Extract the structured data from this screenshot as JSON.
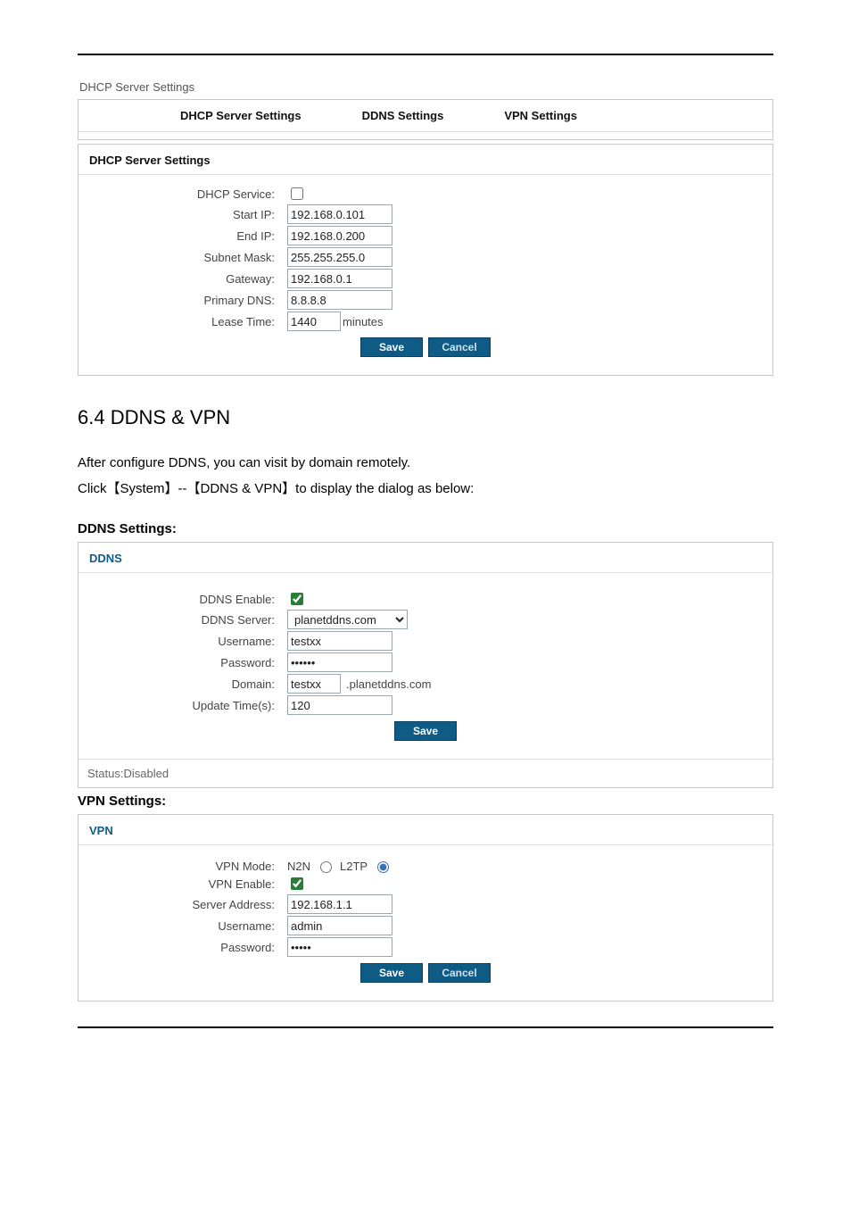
{
  "caption": "DHCP Server Settings",
  "tabs": {
    "dhcp": "DHCP Server Settings",
    "ddns": "DDNS Settings",
    "vpn": "VPN Settings"
  },
  "dhcp": {
    "title": "DHCP Server Settings",
    "labels": {
      "service": "DHCP Service:",
      "start": "Start IP:",
      "end": "End IP:",
      "mask": "Subnet Mask:",
      "gw": "Gateway:",
      "dns": "Primary DNS:",
      "lease": "Lease Time:"
    },
    "values": {
      "start": "192.168.0.101",
      "end": "192.168.0.200",
      "mask": "255.255.255.0",
      "gw": "192.168.0.1",
      "dns": "8.8.8.8",
      "lease": "1440",
      "lease_suffix": "minutes"
    },
    "buttons": {
      "save": "Save",
      "cancel": "Cancel"
    }
  },
  "section_heading": "6.4 DDNS & VPN",
  "body_p1": "After configure DDNS, you can visit by domain remotely.",
  "body_p2": "Click【System】--【DDNS & VPN】to display the dialog as below:",
  "ddns_heading": "DDNS Settings:",
  "ddns": {
    "title": "DDNS",
    "labels": {
      "enable": "DDNS Enable:",
      "server": "DDNS Server:",
      "user": "Username:",
      "pass": "Password:",
      "domain": "Domain:",
      "update": "Update Time(s):"
    },
    "values": {
      "server_option": "planetddns.com",
      "user": "testxx",
      "pass": "••••••",
      "domain_prefix": "testxx",
      "domain_suffix": ".planetddns.com",
      "update": "120"
    },
    "buttons": {
      "save": "Save"
    },
    "status": "Status:Disabled"
  },
  "vpn_heading": "VPN Settings:",
  "vpn": {
    "title": "VPN",
    "labels": {
      "mode": "VPN Mode:",
      "enable": "VPN Enable:",
      "server": "Server Address:",
      "user": "Username:",
      "pass": "Password:"
    },
    "values": {
      "mode_n2n": "N2N",
      "mode_l2tp": "L2TP",
      "server": "192.168.1.1",
      "user": "admin",
      "pass": "•••••"
    },
    "buttons": {
      "save": "Save",
      "cancel": "Cancel"
    }
  }
}
